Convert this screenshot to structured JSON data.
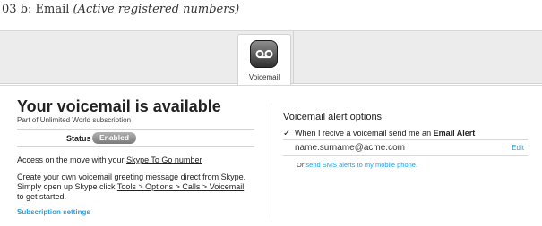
{
  "caption": {
    "prefix": "03 b: Email ",
    "emphasis": "(Active registered numbers)"
  },
  "tabs": {
    "active_label": "Voicemail",
    "active_icon": "voicemail-icon"
  },
  "left": {
    "title": "Your voicemail is available",
    "subtitle": "Part of Unlimited World subscription",
    "status_label": "Status",
    "status_value": "Enabled",
    "access_prefix": "Access on the move with your ",
    "access_link": "Skype To Go number",
    "create_line1": "Create your own voicemail greeting message direct from Skype.",
    "create_line2_prefix": "Simply open up Skype click ",
    "create_line2_link": "Tools > Options > Calls > Voicemail",
    "create_line3": "to get started.",
    "settings_link": "Subscription settings"
  },
  "right": {
    "heading": "Voicemail alert options",
    "checkbox_checked": true,
    "checkbox_symbol": "✓",
    "check_text_prefix": "When I recive a voicemail send me an ",
    "check_text_bold": "Email Alert",
    "email": "name.surname@acme.com",
    "edit_label": "Edit",
    "sms_prefix": "Or ",
    "sms_link": "send SMS alerts to my mobile phone."
  },
  "colors": {
    "link_blue": "#2a9fd8",
    "badge_gray": "#8c8c8c",
    "tabbar_gray": "#ececec"
  }
}
